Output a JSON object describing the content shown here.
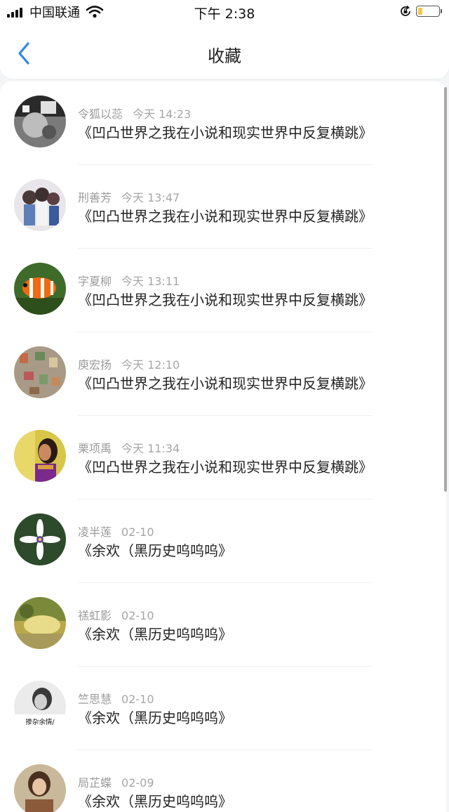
{
  "status_bar": {
    "carrier": "中国联通",
    "time": "下午 2:38"
  },
  "nav": {
    "title": "收藏",
    "back_icon": "chevron-left-icon"
  },
  "colors": {
    "accent": "#2f88e6",
    "battery": "#f2c94c"
  },
  "favorites": [
    {
      "name": "令狐以蕊",
      "time": "今天 14:23",
      "title": "《凹凸世界之我在小说和现实世界中反复横跳》"
    },
    {
      "name": "刑善芳",
      "time": "今天 13:47",
      "title": "《凹凸世界之我在小说和现实世界中反复横跳》"
    },
    {
      "name": "字夏柳",
      "time": "今天 13:11",
      "title": "《凹凸世界之我在小说和现实世界中反复横跳》"
    },
    {
      "name": "庾宏扬",
      "time": "今天 12:10",
      "title": "《凹凸世界之我在小说和现实世界中反复横跳》"
    },
    {
      "name": "栗项禹",
      "time": "今天 11:34",
      "title": "《凹凸世界之我在小说和现实世界中反复横跳》"
    },
    {
      "name": "凌半莲",
      "time": "02-10",
      "title": "《余欢（黑历史呜呜呜》"
    },
    {
      "name": "禚虹影",
      "time": "02-10",
      "title": "《余欢（黑历史呜呜呜》"
    },
    {
      "name": "竺思慧",
      "time": "02-10",
      "title": "《余欢（黑历史呜呜呜》",
      "avatar_caption": "掺杂余情/"
    },
    {
      "name": "局芷蝶",
      "time": "02-09",
      "title": "《余欢（黑历史呜呜呜》"
    }
  ]
}
